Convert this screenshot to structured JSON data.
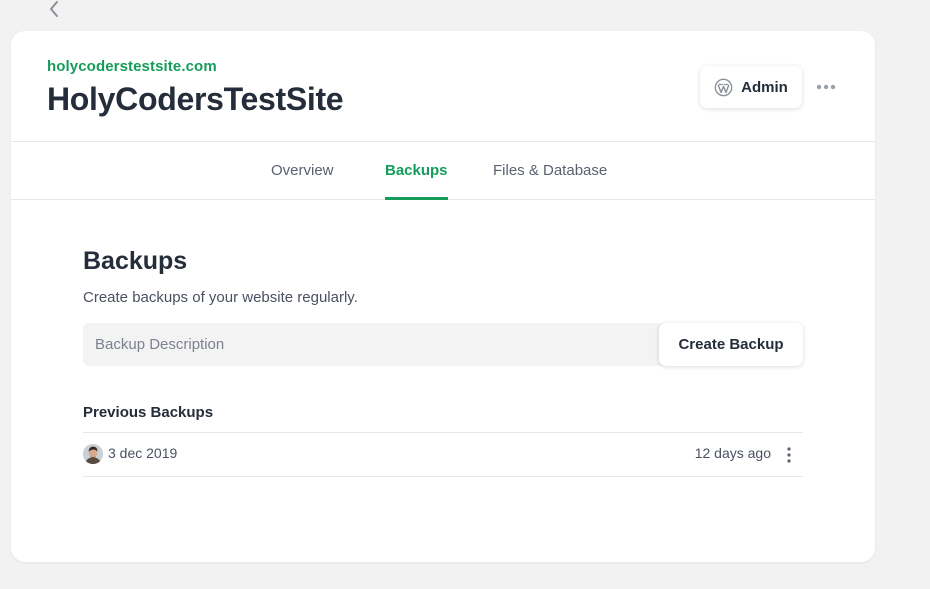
{
  "nav": {
    "back_icon": "chevron-left-icon"
  },
  "site": {
    "url": "holycoderstestsite.com",
    "title": "HolyCodersTestSite"
  },
  "header_actions": {
    "admin_label": "Admin",
    "admin_icon": "wordpress-icon",
    "more_icon": "more-horizontal-icon"
  },
  "tabs": [
    {
      "label": "Overview",
      "active": false
    },
    {
      "label": "Backups",
      "active": true
    },
    {
      "label": "Files & Database",
      "active": false
    }
  ],
  "backups": {
    "title": "Backups",
    "description": "Create backups of your website regularly.",
    "input_placeholder": "Backup Description",
    "input_value": "",
    "create_label": "Create Backup",
    "previous_title": "Previous Backups",
    "items": [
      {
        "avatar_icon": "user-avatar",
        "date": "3 dec 2019",
        "ago": "12 days ago",
        "menu_icon": "more-vertical-icon"
      }
    ]
  },
  "colors": {
    "accent": "#169c5a",
    "page_background": "#f2f2f2",
    "card_background": "#ffffff",
    "text_primary": "#252d3a"
  }
}
